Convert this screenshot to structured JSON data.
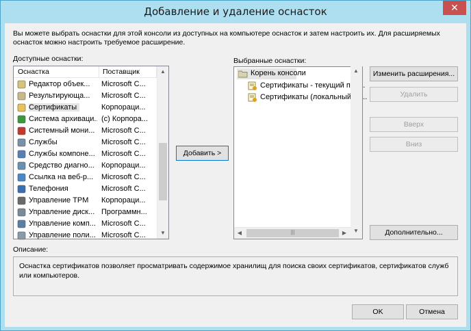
{
  "window": {
    "title": "Добавление и удаление оснасток",
    "close_label": "✕"
  },
  "intro_text": "Вы можете выбрать оснастки для этой консоли из доступных на компьютере оснасток и затем настроить их. Для расширяемых оснасток можно настроить требуемое расширение.",
  "available": {
    "label": "Доступные оснастки:",
    "columns": [
      "Оснастка",
      "Поставщик"
    ],
    "rows": [
      {
        "name": "Редактор объек...",
        "vendor": "Microsoft C...",
        "icon": "policy-editor-icon"
      },
      {
        "name": "Результирующа...",
        "vendor": "Microsoft C...",
        "icon": "rsop-icon"
      },
      {
        "name": "Сертификаты",
        "vendor": "Корпораци...",
        "icon": "certificates-icon"
      },
      {
        "name": "Система архиваци...",
        "vendor": "(c) Корпора...",
        "icon": "backup-icon"
      },
      {
        "name": "Системный мони...",
        "vendor": "Microsoft C...",
        "icon": "system-monitor-icon"
      },
      {
        "name": "Службы",
        "vendor": "Microsoft C...",
        "icon": "services-icon"
      },
      {
        "name": "Службы компоне...",
        "vendor": "Microsoft C...",
        "icon": "component-services-icon"
      },
      {
        "name": "Средство диагно...",
        "vendor": "Корпораци...",
        "icon": "diagnostics-icon"
      },
      {
        "name": "Ссылка на веб-р...",
        "vendor": "Microsoft C...",
        "icon": "web-link-icon"
      },
      {
        "name": "Телефония",
        "vendor": "Microsoft C...",
        "icon": "telephony-icon"
      },
      {
        "name": "Управление TPM",
        "vendor": "Корпораци...",
        "icon": "tpm-icon"
      },
      {
        "name": "Управление диск...",
        "vendor": "Программн...",
        "icon": "disk-management-icon"
      },
      {
        "name": "Управление комп...",
        "vendor": "Microsoft C...",
        "icon": "computer-management-icon"
      },
      {
        "name": "Управление поли...",
        "vendor": "Microsoft C...",
        "icon": "policy-management-icon"
      }
    ]
  },
  "add_button": "Добавить >",
  "selected": {
    "label": "Выбранные оснастки:",
    "root": "Корень консоли",
    "children": [
      "Сертификаты - текущий пол...",
      "Сертификаты (локальный ко..."
    ]
  },
  "buttons": {
    "edit_extensions": "Изменить расширения...",
    "remove": "Удалить",
    "up": "Вверх",
    "down": "Вниз",
    "advanced": "Дополнительно...",
    "ok": "OK",
    "cancel": "Отмена"
  },
  "description": {
    "label": "Описание:",
    "text": "Оснастка сертификатов позволяет просматривать содержимое хранилищ для поиска своих сертификатов, сертификатов служб или компьютеров."
  }
}
